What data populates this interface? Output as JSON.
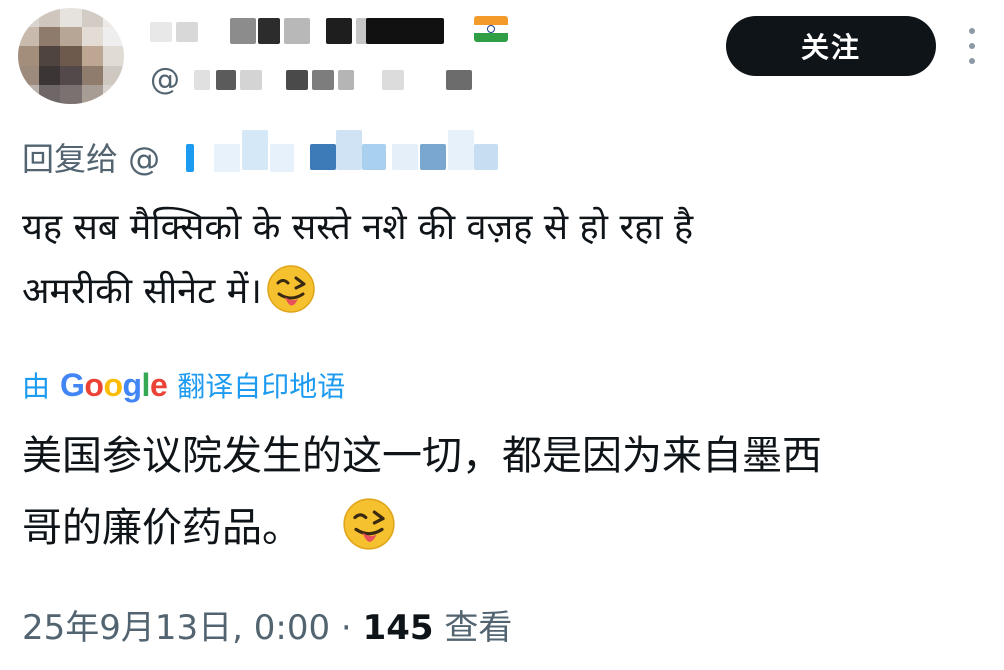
{
  "author": {
    "flag": "india-flag",
    "handle_prefix": "@"
  },
  "header": {
    "follow_label": "关注",
    "more_icon": "more-vertical-icon"
  },
  "reply": {
    "label": "回复给 @"
  },
  "post": {
    "original_line_1": "यह सब मैक्सिको के सस्ते नशे की वज़ह से हो रहा है",
    "original_line_2": "अमरीकी सीनेट में।",
    "emoji": "😜"
  },
  "translation": {
    "prefix": "由",
    "brand_parts": [
      "G",
      "o",
      "o",
      "g",
      "l",
      "e"
    ],
    "suffix": "翻译自印地语",
    "line_1": "美国参议院发生的这一切，都是因为来自墨西",
    "line_2": "哥的廉价药品。"
  },
  "meta": {
    "timestamp": "25年9月13日, 0:00",
    "separator": " · ",
    "views_count": "145",
    "views_label": " 查看"
  },
  "colors": {
    "accent": "#1d9bf0",
    "text": "#0f1419",
    "muted": "#536471",
    "button_bg": "#0f1419"
  }
}
